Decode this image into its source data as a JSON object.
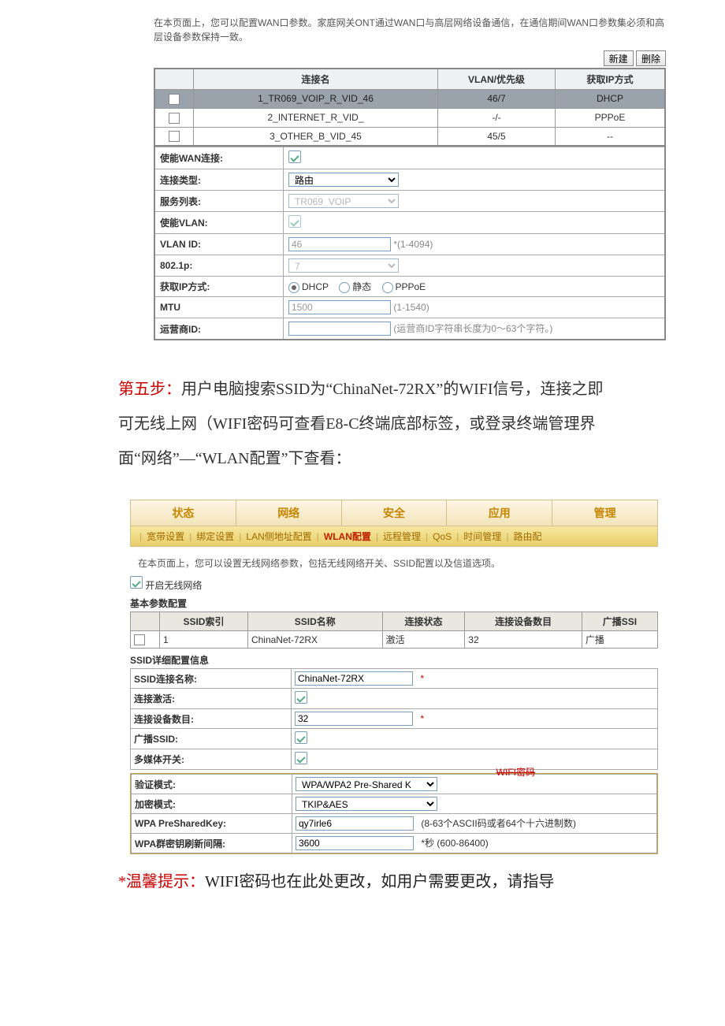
{
  "wan": {
    "intro": "在本页面上，您可以配置WAN口参数。家庭网关ONT通过WAN口与高层网络设备通信，在通信期间WAN口参数集必须和高层设备参数保持一致。",
    "btn_new": "新建",
    "btn_del": "删除",
    "headers": {
      "name": "连接名",
      "vlan": "VLAN/优先级",
      "ip": "获取IP方式"
    },
    "rows": [
      {
        "name": "1_TR069_VOIP_R_VID_46",
        "vlan": "46/7",
        "ip": "DHCP",
        "selected": true
      },
      {
        "name": "2_INTERNET_R_VID_",
        "vlan": "-/-",
        "ip": "PPPoE",
        "selected": false
      },
      {
        "name": "3_OTHER_B_VID_45",
        "vlan": "45/5",
        "ip": "--",
        "selected": false
      }
    ],
    "form": {
      "enable_label": "使能WAN连接:",
      "conn_type_label": "连接类型:",
      "conn_type_value": "路由",
      "svc_list_label": "服务列表:",
      "svc_list_value": "TR069_VOIP",
      "vlan_enable_label": "使能VLAN:",
      "vlan_id_label": "VLAN ID:",
      "vlan_id_value": "46",
      "vlan_id_hint": "*(1-4094)",
      "dot1p_label": "802.1p:",
      "dot1p_value": "7",
      "ipmode_label": "获取IP方式:",
      "ipmode_dhcp": "DHCP",
      "ipmode_static": "静态",
      "ipmode_pppoe": "PPPoE",
      "mtu_label": "MTU",
      "mtu_value": "1500",
      "mtu_hint": "(1-1540)",
      "carrier_label": "运营商ID:",
      "carrier_hint": "(运营商ID字符串长度为0～63个字符。)"
    }
  },
  "doc": {
    "lead": "第五步：",
    "body": "用户电脑搜索SSID为“ChinaNet-72RX”的WIFI信号，连接之即可无线上网（WIFI密码可查看E8-C终端底部标签，或登录终端管理界面“网络”—“WLAN配置”下查看："
  },
  "nav": {
    "tabs": [
      "状态",
      "网络",
      "安全",
      "应用",
      "管理"
    ],
    "sub": [
      "宽带设置",
      "绑定设置",
      "LAN侧地址配置",
      "WLAN配置",
      "远程管理",
      "QoS",
      "时间管理",
      "路由配"
    ]
  },
  "wlan": {
    "intro": "在本页面上，您可以设置无线网络参数，包括无线网络开关、SSID配置以及信道选项。",
    "enable_label": "开启无线网络",
    "basic_title": "基本参数配置",
    "list_headers": {
      "idx": "SSID索引",
      "name": "SSID名称",
      "state": "连接状态",
      "count": "连接设备数目",
      "bcast": "广播SSI"
    },
    "list_row": {
      "idx": "1",
      "name": "ChinaNet-72RX",
      "state": "激活",
      "count": "32",
      "bcast": "广播"
    },
    "detail_title": "SSID详细配置信息",
    "form": {
      "ssid_name_label": "SSID连接名称:",
      "ssid_name_val": "ChinaNet-72RX",
      "active_label": "连接激活:",
      "count_label": "连接设备数目:",
      "count_val": "32",
      "bcast_label": "广播SSID:",
      "media_label": "多媒体开关:",
      "auth_label": "验证模式:",
      "auth_val": "WPA/WPA2 Pre-Shared K",
      "enc_label": "加密模式:",
      "enc_val": "TKIP&AES",
      "psk_label": "WPA PreSharedKey:",
      "psk_val": "qy7irle6",
      "psk_hint": "(8-63个ASCII码或者64个十六进制数)",
      "rekey_label": "WPA群密钥刷新间隔:",
      "rekey_val": "3600",
      "rekey_hint": "*秒 (600-86400)",
      "pw_tag": "WIFI密码"
    }
  },
  "tip": {
    "lead": "*温馨提示：",
    "rest": "WIFI密码也在此处更改，如用户需要更改，请指导"
  }
}
